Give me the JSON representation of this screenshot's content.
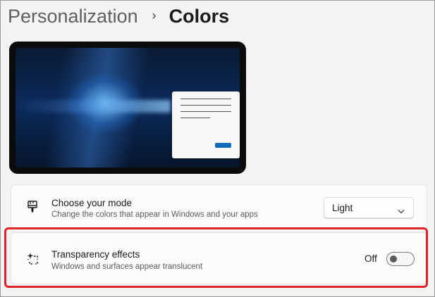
{
  "breadcrumb": {
    "parent": "Personalization",
    "separator": "›",
    "current": "Colors"
  },
  "preview": {
    "wallpaper": "windows-hero-blue",
    "window_accent": "#0f6cbd"
  },
  "settings": [
    {
      "id": "mode",
      "icon": "paintbrush-icon",
      "title": "Choose your mode",
      "subtitle": "Change the colors that appear in Windows and your apps",
      "control": "dropdown",
      "value": "Light"
    },
    {
      "id": "transparency",
      "icon": "sparkle-selection-icon",
      "title": "Transparency effects",
      "subtitle": "Windows and surfaces appear translucent",
      "control": "toggle",
      "state_label": "Off",
      "on": false
    }
  ],
  "annotation": {
    "highlight_color": "#e0242a",
    "highlighted_setting": "transparency"
  }
}
